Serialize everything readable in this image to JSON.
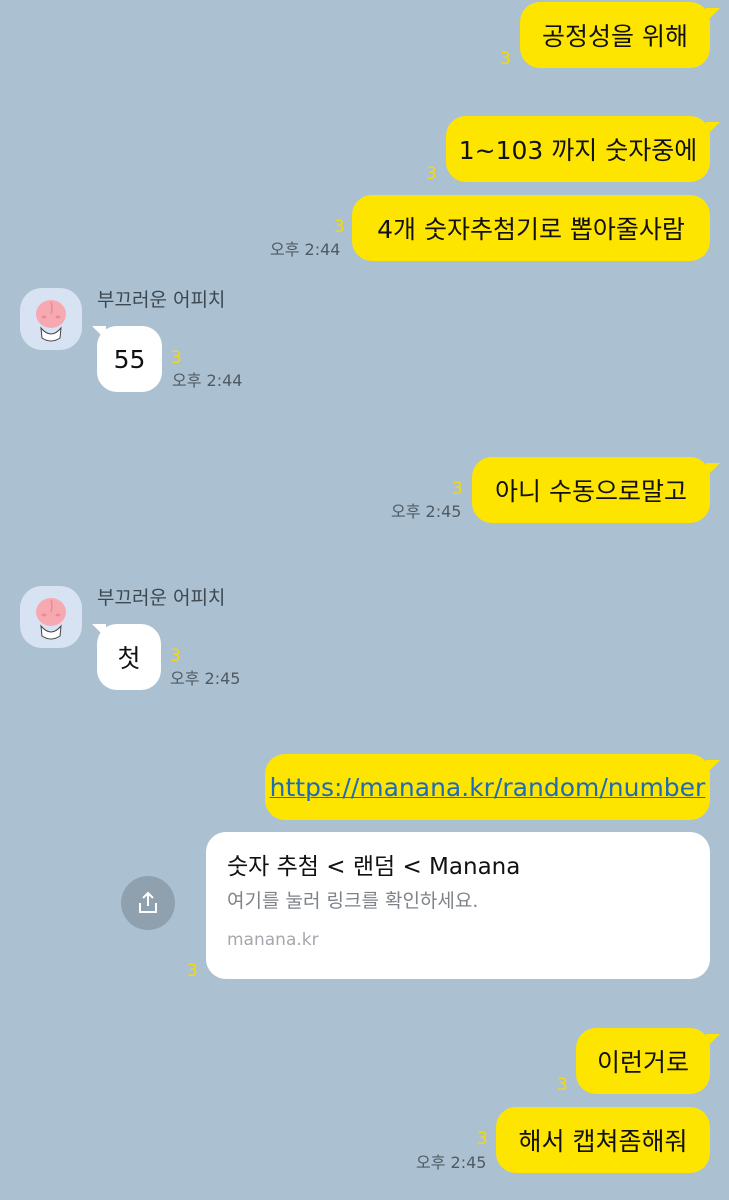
{
  "messages": {
    "m1": {
      "text": "공정성을 위해",
      "unread": "3"
    },
    "m2": {
      "text": "1~103 까지 숫자중에",
      "unread": "3"
    },
    "m3": {
      "text": "4개 숫자추첨기로 뽑아줄사람",
      "unread": "3",
      "time": "오후 2:44"
    },
    "m4": {
      "sender": "부끄러운 어피치",
      "text": "55",
      "unread": "3",
      "time": "오후 2:44"
    },
    "m5": {
      "text": "아니 수동으로말고",
      "unread": "3",
      "time": "오후 2:45"
    },
    "m6": {
      "sender": "부끄러운 어피치",
      "text": "첫",
      "unread": "3",
      "time": "오후 2:45"
    },
    "m7": {
      "text": "https://manana.kr/random/number"
    },
    "m8": {
      "card_title": "숫자 추첨 < 랜덤 < Manana",
      "card_desc": "여기를 눌러 링크를 확인하세요.",
      "card_domain": "manana.kr",
      "unread": "3"
    },
    "m9": {
      "text": "이런거로",
      "unread": "3"
    },
    "m10": {
      "text": "해서 캡쳐좀해줘",
      "unread": "3",
      "time": "오후 2:45"
    }
  },
  "icons": {
    "avatar": "apeach-avatar-icon",
    "share": "share-icon"
  },
  "colors": {
    "background": "#abc1d1",
    "my_bubble": "#fee500",
    "their_bubble": "#ffffff",
    "unread_count": "#f6d807",
    "link": "#1e6bb8"
  }
}
